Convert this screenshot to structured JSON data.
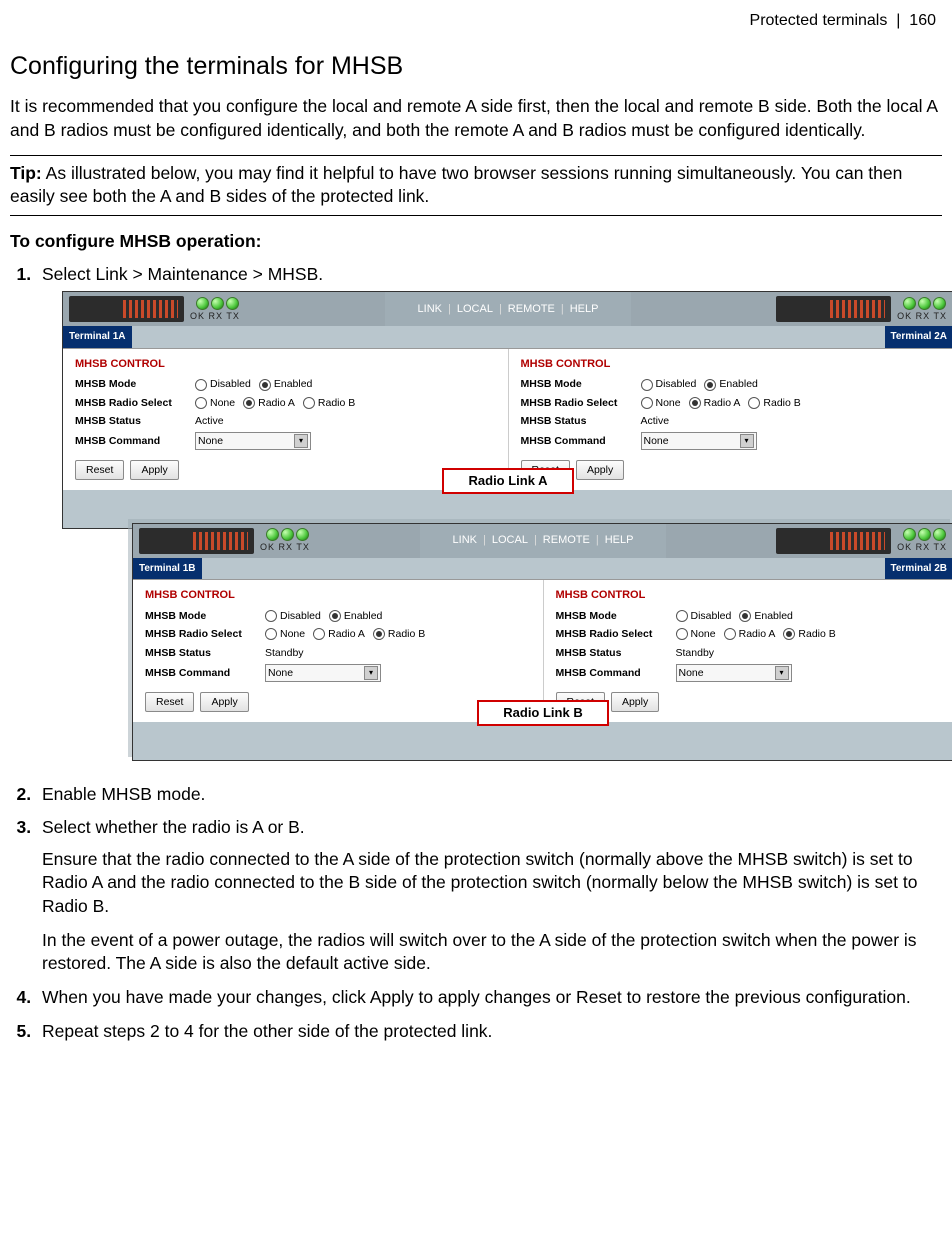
{
  "header": {
    "section": "Protected terminals",
    "sep": "|",
    "page": "160"
  },
  "title": "Configuring the terminals for MHSB",
  "intro": "It is recommended that you configure the local and remote A side first, then the local and remote B side. Both the local A and B radios must be configured identically, and both the remote A and B radios must be configured identically.",
  "tip_label": "Tip:",
  "tip_text": " As illustrated below, you may find it helpful to have two browser sessions running simultaneously. You can then easily see both the A and B sides of the protected link.",
  "subheading": "To configure MHSB operation:",
  "steps": {
    "s1": "Select Link > Maintenance > MHSB.",
    "s2": "Enable MHSB mode.",
    "s3": "Select whether the radio is A or B.",
    "s3a": "Ensure that the radio connected to the A side of the protection switch (normally above the MHSB switch) is set to Radio A and the radio connected to the B side of the protection switch (normally below the MHSB switch) is set to Radio B.",
    "s3b": "In the event of a power outage, the radios will switch over to the A side of the protection switch when the power is restored. The A side is also the default active side.",
    "s4": "When you have made your changes, click Apply to apply changes or Reset to restore the previous configuration.",
    "s5": "Repeat steps 2 to 4 for the other side of the protected link."
  },
  "ui": {
    "nav": [
      "LINK",
      "LOCAL",
      "REMOTE",
      "HELP"
    ],
    "led_labels": "OK  RX  TX",
    "control_title": "MHSB CONTROL",
    "labels": {
      "mode": "MHSB Mode",
      "radio_sel": "MHSB Radio Select",
      "status": "MHSB Status",
      "command": "MHSB Command"
    },
    "opts": {
      "disabled": "Disabled",
      "enabled": "Enabled",
      "none": "None",
      "radio_a": "Radio A",
      "radio_b": "Radio B"
    },
    "cmd_value": "None",
    "btn_reset": "Reset",
    "btn_apply": "Apply",
    "terminals": {
      "t1a": "Terminal 1A",
      "t2a": "Terminal 2A",
      "t1b": "Terminal 1B",
      "t2b": "Terminal 2B"
    },
    "status_active": "Active",
    "status_standby": "Standby",
    "link_a": "Radio Link A",
    "link_b": "Radio Link B"
  }
}
